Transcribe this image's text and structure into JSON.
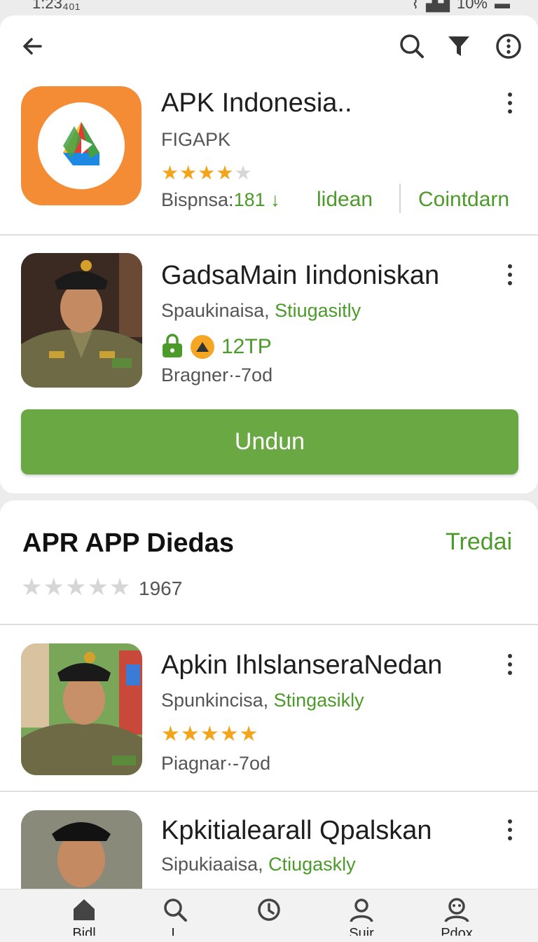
{
  "status": {
    "time": "1:23₄₀₁",
    "battery": "10%"
  },
  "featured": {
    "title": "APK Indonesia..",
    "developer": "FIGAPK",
    "rating": 3.5,
    "downloads_label": "Bispnsa:",
    "downloads_value": "181",
    "link1": "lidean",
    "link2": "Cointdarn"
  },
  "item1": {
    "title": "GadsaMain Iindoniskan",
    "meta_plain": "Spaukinaisa, ",
    "meta_green": "Stiugasitly",
    "badge": "12TP",
    "size": "Bragner·-7od"
  },
  "install_button": "Undun",
  "section": {
    "title": "APR APP Diedas",
    "action": "Tredai",
    "rating_count": "1967"
  },
  "item2": {
    "title": "Apkin IhlslanseraNedan",
    "meta_plain": "Spunkincisa, ",
    "meta_green": "Stingasikly",
    "rating": 4.5,
    "size": "Piagnar·-7od"
  },
  "item3": {
    "title": "Kpkitialearall Qpalskan",
    "meta_plain": "Sipukiaaisa, ",
    "meta_green": "Ctiugaskly"
  },
  "bottom_nav": [
    {
      "label": "Bidl",
      "icon": "home-icon"
    },
    {
      "label": "L",
      "icon": "search-icon"
    },
    {
      "label": "",
      "icon": "history-icon"
    },
    {
      "label": "Sujr",
      "icon": "profile-icon"
    },
    {
      "label": "Pdox",
      "icon": "community-icon"
    }
  ],
  "colors": {
    "accent_green": "#4c9a2a",
    "button_green": "#6aa843",
    "icon_orange": "#f48b35",
    "star": "#f2a51b"
  }
}
